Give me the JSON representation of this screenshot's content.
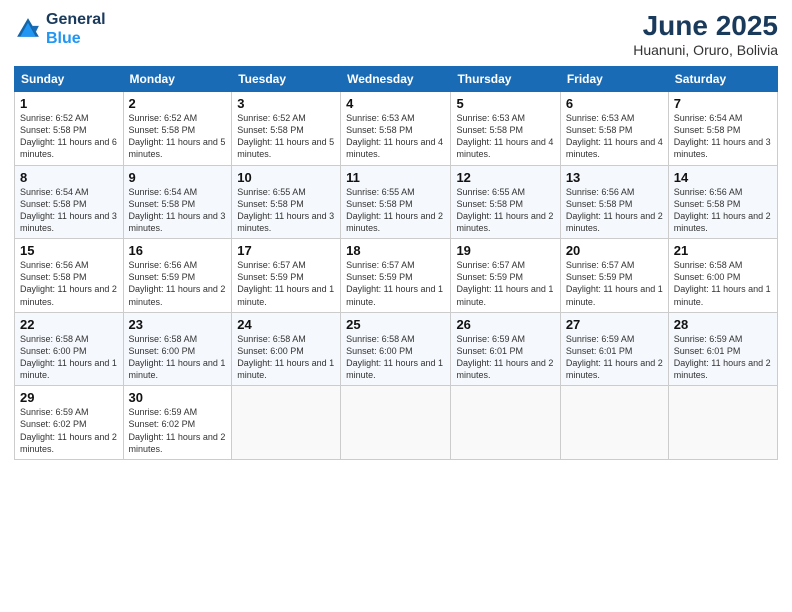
{
  "header": {
    "logo_line1": "General",
    "logo_line2": "Blue",
    "title": "June 2025",
    "subtitle": "Huanuni, Oruro, Bolivia"
  },
  "columns": [
    "Sunday",
    "Monday",
    "Tuesday",
    "Wednesday",
    "Thursday",
    "Friday",
    "Saturday"
  ],
  "weeks": [
    [
      {
        "day": "1",
        "sunrise": "6:52 AM",
        "sunset": "5:58 PM",
        "daylight": "11 hours and 6 minutes."
      },
      {
        "day": "2",
        "sunrise": "6:52 AM",
        "sunset": "5:58 PM",
        "daylight": "11 hours and 5 minutes."
      },
      {
        "day": "3",
        "sunrise": "6:52 AM",
        "sunset": "5:58 PM",
        "daylight": "11 hours and 5 minutes."
      },
      {
        "day": "4",
        "sunrise": "6:53 AM",
        "sunset": "5:58 PM",
        "daylight": "11 hours and 4 minutes."
      },
      {
        "day": "5",
        "sunrise": "6:53 AM",
        "sunset": "5:58 PM",
        "daylight": "11 hours and 4 minutes."
      },
      {
        "day": "6",
        "sunrise": "6:53 AM",
        "sunset": "5:58 PM",
        "daylight": "11 hours and 4 minutes."
      },
      {
        "day": "7",
        "sunrise": "6:54 AM",
        "sunset": "5:58 PM",
        "daylight": "11 hours and 3 minutes."
      }
    ],
    [
      {
        "day": "8",
        "sunrise": "6:54 AM",
        "sunset": "5:58 PM",
        "daylight": "11 hours and 3 minutes."
      },
      {
        "day": "9",
        "sunrise": "6:54 AM",
        "sunset": "5:58 PM",
        "daylight": "11 hours and 3 minutes."
      },
      {
        "day": "10",
        "sunrise": "6:55 AM",
        "sunset": "5:58 PM",
        "daylight": "11 hours and 3 minutes."
      },
      {
        "day": "11",
        "sunrise": "6:55 AM",
        "sunset": "5:58 PM",
        "daylight": "11 hours and 2 minutes."
      },
      {
        "day": "12",
        "sunrise": "6:55 AM",
        "sunset": "5:58 PM",
        "daylight": "11 hours and 2 minutes."
      },
      {
        "day": "13",
        "sunrise": "6:56 AM",
        "sunset": "5:58 PM",
        "daylight": "11 hours and 2 minutes."
      },
      {
        "day": "14",
        "sunrise": "6:56 AM",
        "sunset": "5:58 PM",
        "daylight": "11 hours and 2 minutes."
      }
    ],
    [
      {
        "day": "15",
        "sunrise": "6:56 AM",
        "sunset": "5:58 PM",
        "daylight": "11 hours and 2 minutes."
      },
      {
        "day": "16",
        "sunrise": "6:56 AM",
        "sunset": "5:59 PM",
        "daylight": "11 hours and 2 minutes."
      },
      {
        "day": "17",
        "sunrise": "6:57 AM",
        "sunset": "5:59 PM",
        "daylight": "11 hours and 1 minute."
      },
      {
        "day": "18",
        "sunrise": "6:57 AM",
        "sunset": "5:59 PM",
        "daylight": "11 hours and 1 minute."
      },
      {
        "day": "19",
        "sunrise": "6:57 AM",
        "sunset": "5:59 PM",
        "daylight": "11 hours and 1 minute."
      },
      {
        "day": "20",
        "sunrise": "6:57 AM",
        "sunset": "5:59 PM",
        "daylight": "11 hours and 1 minute."
      },
      {
        "day": "21",
        "sunrise": "6:58 AM",
        "sunset": "6:00 PM",
        "daylight": "11 hours and 1 minute."
      }
    ],
    [
      {
        "day": "22",
        "sunrise": "6:58 AM",
        "sunset": "6:00 PM",
        "daylight": "11 hours and 1 minute."
      },
      {
        "day": "23",
        "sunrise": "6:58 AM",
        "sunset": "6:00 PM",
        "daylight": "11 hours and 1 minute."
      },
      {
        "day": "24",
        "sunrise": "6:58 AM",
        "sunset": "6:00 PM",
        "daylight": "11 hours and 1 minute."
      },
      {
        "day": "25",
        "sunrise": "6:58 AM",
        "sunset": "6:00 PM",
        "daylight": "11 hours and 1 minute."
      },
      {
        "day": "26",
        "sunrise": "6:59 AM",
        "sunset": "6:01 PM",
        "daylight": "11 hours and 2 minutes."
      },
      {
        "day": "27",
        "sunrise": "6:59 AM",
        "sunset": "6:01 PM",
        "daylight": "11 hours and 2 minutes."
      },
      {
        "day": "28",
        "sunrise": "6:59 AM",
        "sunset": "6:01 PM",
        "daylight": "11 hours and 2 minutes."
      }
    ],
    [
      {
        "day": "29",
        "sunrise": "6:59 AM",
        "sunset": "6:02 PM",
        "daylight": "11 hours and 2 minutes."
      },
      {
        "day": "30",
        "sunrise": "6:59 AM",
        "sunset": "6:02 PM",
        "daylight": "11 hours and 2 minutes."
      },
      null,
      null,
      null,
      null,
      null
    ]
  ]
}
